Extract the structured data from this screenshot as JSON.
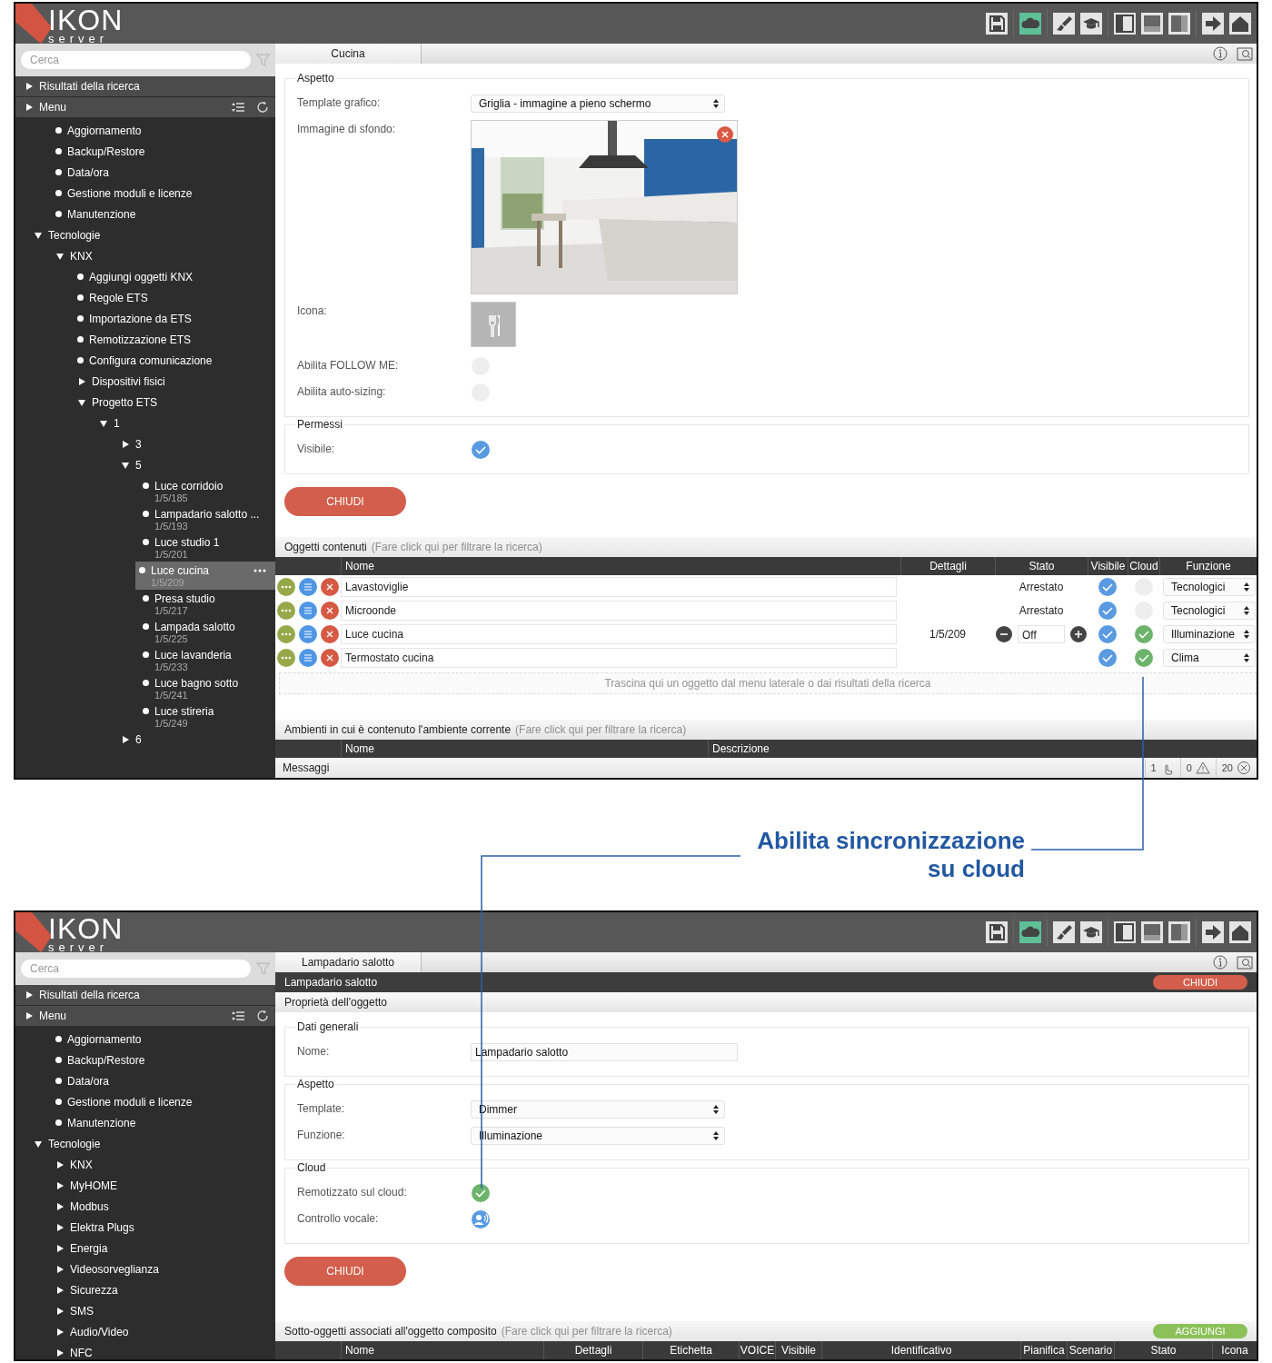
{
  "screens": [
    {
      "logo": {
        "title": "IKON",
        "subtitle": "server"
      },
      "toolbar": [
        {
          "kind": "save",
          "active": false
        },
        {
          "kind": "cloud",
          "active": true
        },
        {
          "kind": "brush",
          "active": false
        },
        {
          "kind": "cap",
          "active": false
        },
        {
          "kind": "panel-left",
          "active": false
        },
        {
          "kind": "panel-bottom",
          "active": false
        },
        {
          "kind": "panel-right",
          "active": false
        },
        {
          "kind": "exit",
          "active": false
        },
        {
          "kind": "home",
          "active": false
        }
      ],
      "sidebar": {
        "search": {
          "placeholder": "Cerca"
        },
        "bars": [
          "Risultati della ricerca",
          "Menu"
        ],
        "tree": [
          {
            "label": "Aggiornamento",
            "selected": false
          },
          {
            "label": "Backup/Restore",
            "selected": false
          },
          {
            "label": "Data/ora",
            "selected": false
          },
          {
            "label": "Gestione moduli e licenze",
            "selected": false
          },
          {
            "label": "Manutenzione",
            "selected": false
          },
          {
            "label": "Tecnologie",
            "selected": false,
            "expanded": true,
            "children": [
              {
                "label": "KNX",
                "selected": false,
                "expanded": true,
                "children": [
                  {
                    "label": "Aggiungi oggetti KNX",
                    "selected": false
                  },
                  {
                    "label": "Regole ETS",
                    "selected": false
                  },
                  {
                    "label": "Importazione da ETS",
                    "selected": false
                  },
                  {
                    "label": "Remotizzazione ETS",
                    "selected": false
                  },
                  {
                    "label": "Configura comunicazione",
                    "selected": false
                  },
                  {
                    "label": "Dispositivi fisici",
                    "selected": false,
                    "expanded": false
                  },
                  {
                    "label": "Progetto ETS",
                    "selected": false,
                    "expanded": true,
                    "children": [
                      {
                        "label": "1",
                        "selected": false,
                        "expanded": true,
                        "children": [
                          {
                            "label": "3",
                            "selected": false,
                            "expanded": false
                          },
                          {
                            "label": "5",
                            "selected": false,
                            "expanded": true,
                            "children": [
                              {
                                "label": "Luce corridoio",
                                "address": "1/5/185",
                                "selected": false
                              },
                              {
                                "label": "Lampadario salotto ...",
                                "address": "1/5/193",
                                "selected": false
                              },
                              {
                                "label": "Luce studio 1",
                                "address": "1/5/201",
                                "selected": false
                              },
                              {
                                "label": "Luce cucina",
                                "address": "1/5/209",
                                "selected": true
                              },
                              {
                                "label": "Presa studio",
                                "address": "1/5/217",
                                "selected": false
                              },
                              {
                                "label": "Lampada salotto",
                                "address": "1/5/225",
                                "selected": false
                              },
                              {
                                "label": "Luce lavanderia",
                                "address": "1/5/233",
                                "selected": false
                              },
                              {
                                "label": "Luce bagno sotto",
                                "address": "1/5/241",
                                "selected": false
                              },
                              {
                                "label": "Luce stireria",
                                "address": "1/5/249",
                                "selected": false
                              }
                            ]
                          },
                          {
                            "label": "6",
                            "selected": false,
                            "expanded": false
                          }
                        ]
                      }
                    ]
                  }
                ]
              }
            ]
          }
        ]
      },
      "tab": {
        "label": "Cucina",
        "selected": true
      },
      "form": {
        "fieldsets": [
          {
            "legend": "Aspetto",
            "rows": [
              {
                "label": "Template grafico:",
                "kind": "select",
                "value": "Griglia - immagine a pieno schermo"
              },
              {
                "label": "Immagine di sfondo:",
                "kind": "picture"
              },
              {
                "label": "Icona:",
                "kind": "icon"
              },
              {
                "label": "Abilita FOLLOW ME:",
                "kind": "toggle",
                "on": false
              },
              {
                "label": "Abilita auto-sizing:",
                "kind": "toggle",
                "on": false
              }
            ]
          },
          {
            "legend": "Permessi",
            "rows": [
              {
                "label": "Visibile:",
                "kind": "check",
                "on": true
              }
            ]
          }
        ],
        "close_label": "CHIUDI"
      },
      "sections": [
        {
          "kind": "objects",
          "title": "Oggetti contenuti",
          "hint": "(Fare click qui per filtrare la ricerca)",
          "columns": [
            "Nome",
            "Dettagli",
            "Stato",
            "Visibile",
            "Cloud",
            "Funzione"
          ],
          "rows": [
            {
              "name": "Lavastoviglie",
              "status": {
                "kind": "text",
                "text": "Arrestato"
              },
              "visible": true,
              "cloud": false,
              "function": "Tecnologici"
            },
            {
              "name": "Microonde",
              "status": {
                "kind": "text",
                "text": "Arrestato"
              },
              "visible": true,
              "cloud": false,
              "function": "Tecnologici"
            },
            {
              "name": "Luce cucina",
              "details": "1/5/209",
              "status": {
                "kind": "dimmer",
                "value": "Off"
              },
              "visible": true,
              "cloud": true,
              "function": "Illuminazione"
            },
            {
              "name": "Termostato cucina",
              "visible": true,
              "cloud": true,
              "function": "Clima"
            }
          ],
          "dropzone": "Trascina qui un oggetto dal menu laterale o dai risultati della ricerca"
        },
        {
          "kind": "rooms",
          "title": "Ambienti in cui è contenuto l'ambiente corrente",
          "hint": "(Fare click qui per filtrare la ricerca)",
          "columns": [
            "Nome",
            "Descrizione"
          ]
        }
      ],
      "status_bar": {
        "label": "Messaggi",
        "counters": [
          {
            "kind": "touch",
            "count": "1"
          },
          {
            "kind": "warning",
            "count": "0"
          },
          {
            "kind": "error",
            "count": "20"
          }
        ]
      }
    },
    {
      "logo": {
        "title": "IKON",
        "subtitle": "server"
      },
      "toolbar": [
        {
          "kind": "save",
          "active": false
        },
        {
          "kind": "cloud",
          "active": true
        },
        {
          "kind": "brush",
          "active": false
        },
        {
          "kind": "cap",
          "active": false
        },
        {
          "kind": "panel-left",
          "active": false
        },
        {
          "kind": "panel-bottom",
          "active": false
        },
        {
          "kind": "panel-right",
          "active": false
        },
        {
          "kind": "exit",
          "active": false
        },
        {
          "kind": "home",
          "active": false
        }
      ],
      "sidebar": {
        "search": {
          "placeholder": "Cerca"
        },
        "bars": [
          "Risultati della ricerca",
          "Menu"
        ],
        "tree": [
          {
            "label": "Aggiornamento",
            "selected": false
          },
          {
            "label": "Backup/Restore",
            "selected": false
          },
          {
            "label": "Data/ora",
            "selected": false
          },
          {
            "label": "Gestione moduli e licenze",
            "selected": false
          },
          {
            "label": "Manutenzione",
            "selected": false
          },
          {
            "label": "Tecnologie",
            "selected": false,
            "expanded": true,
            "children": [
              {
                "label": "KNX",
                "selected": false,
                "expanded": false
              },
              {
                "label": "MyHOME",
                "selected": false,
                "expanded": false
              },
              {
                "label": "Modbus",
                "selected": false,
                "expanded": false
              },
              {
                "label": "Elektra Plugs",
                "selected": false,
                "expanded": false
              },
              {
                "label": "Energia",
                "selected": false,
                "expanded": false
              },
              {
                "label": "Videosorveglianza",
                "selected": false,
                "expanded": false
              },
              {
                "label": "Sicurezza",
                "selected": false,
                "expanded": false
              },
              {
                "label": "SMS",
                "selected": false,
                "expanded": false
              },
              {
                "label": "Audio/Video",
                "selected": false,
                "expanded": false
              },
              {
                "label": "NFC",
                "selected": false,
                "expanded": false
              }
            ]
          }
        ]
      },
      "tab": {
        "label": "Lampadario salotto",
        "selected": true
      },
      "object_bar": {
        "title": "Lampadario salotto",
        "close_label": "CHIUDI"
      },
      "properties_header": "Proprietà dell'oggetto",
      "form": {
        "fieldsets": [
          {
            "legend": "Dati generali",
            "rows": [
              {
                "label": "Nome:",
                "kind": "input",
                "value": "Lampadario salotto"
              }
            ]
          },
          {
            "legend": "Aspetto",
            "rows": [
              {
                "label": "Template:",
                "kind": "select",
                "value": "Dimmer"
              },
              {
                "label": "Funzione:",
                "kind": "select",
                "value": "Illuminazione"
              }
            ]
          },
          {
            "legend": "Cloud",
            "rows": [
              {
                "label": "Remotizzato sul cloud:",
                "kind": "cloud",
                "on": true
              },
              {
                "label": "Controllo vocale:",
                "kind": "voice",
                "on": true
              }
            ]
          }
        ],
        "close_label": "CHIUDI"
      },
      "sections": [
        {
          "kind": "subobjects",
          "title": "Sotto-oggetti associati all'oggetto composito",
          "hint": "(Fare click qui per filtrare la ricerca)",
          "add_label": "AGGIUNGI",
          "columns": [
            "Nome",
            "Dettagli",
            "Etichetta",
            "VOICE",
            "Visibile",
            "Identificativo",
            "Pianifica",
            "Scenario",
            "Stato",
            "Icona"
          ]
        }
      ]
    }
  ],
  "annotation": {
    "text": "Abilita sincronizzazione su cloud"
  }
}
